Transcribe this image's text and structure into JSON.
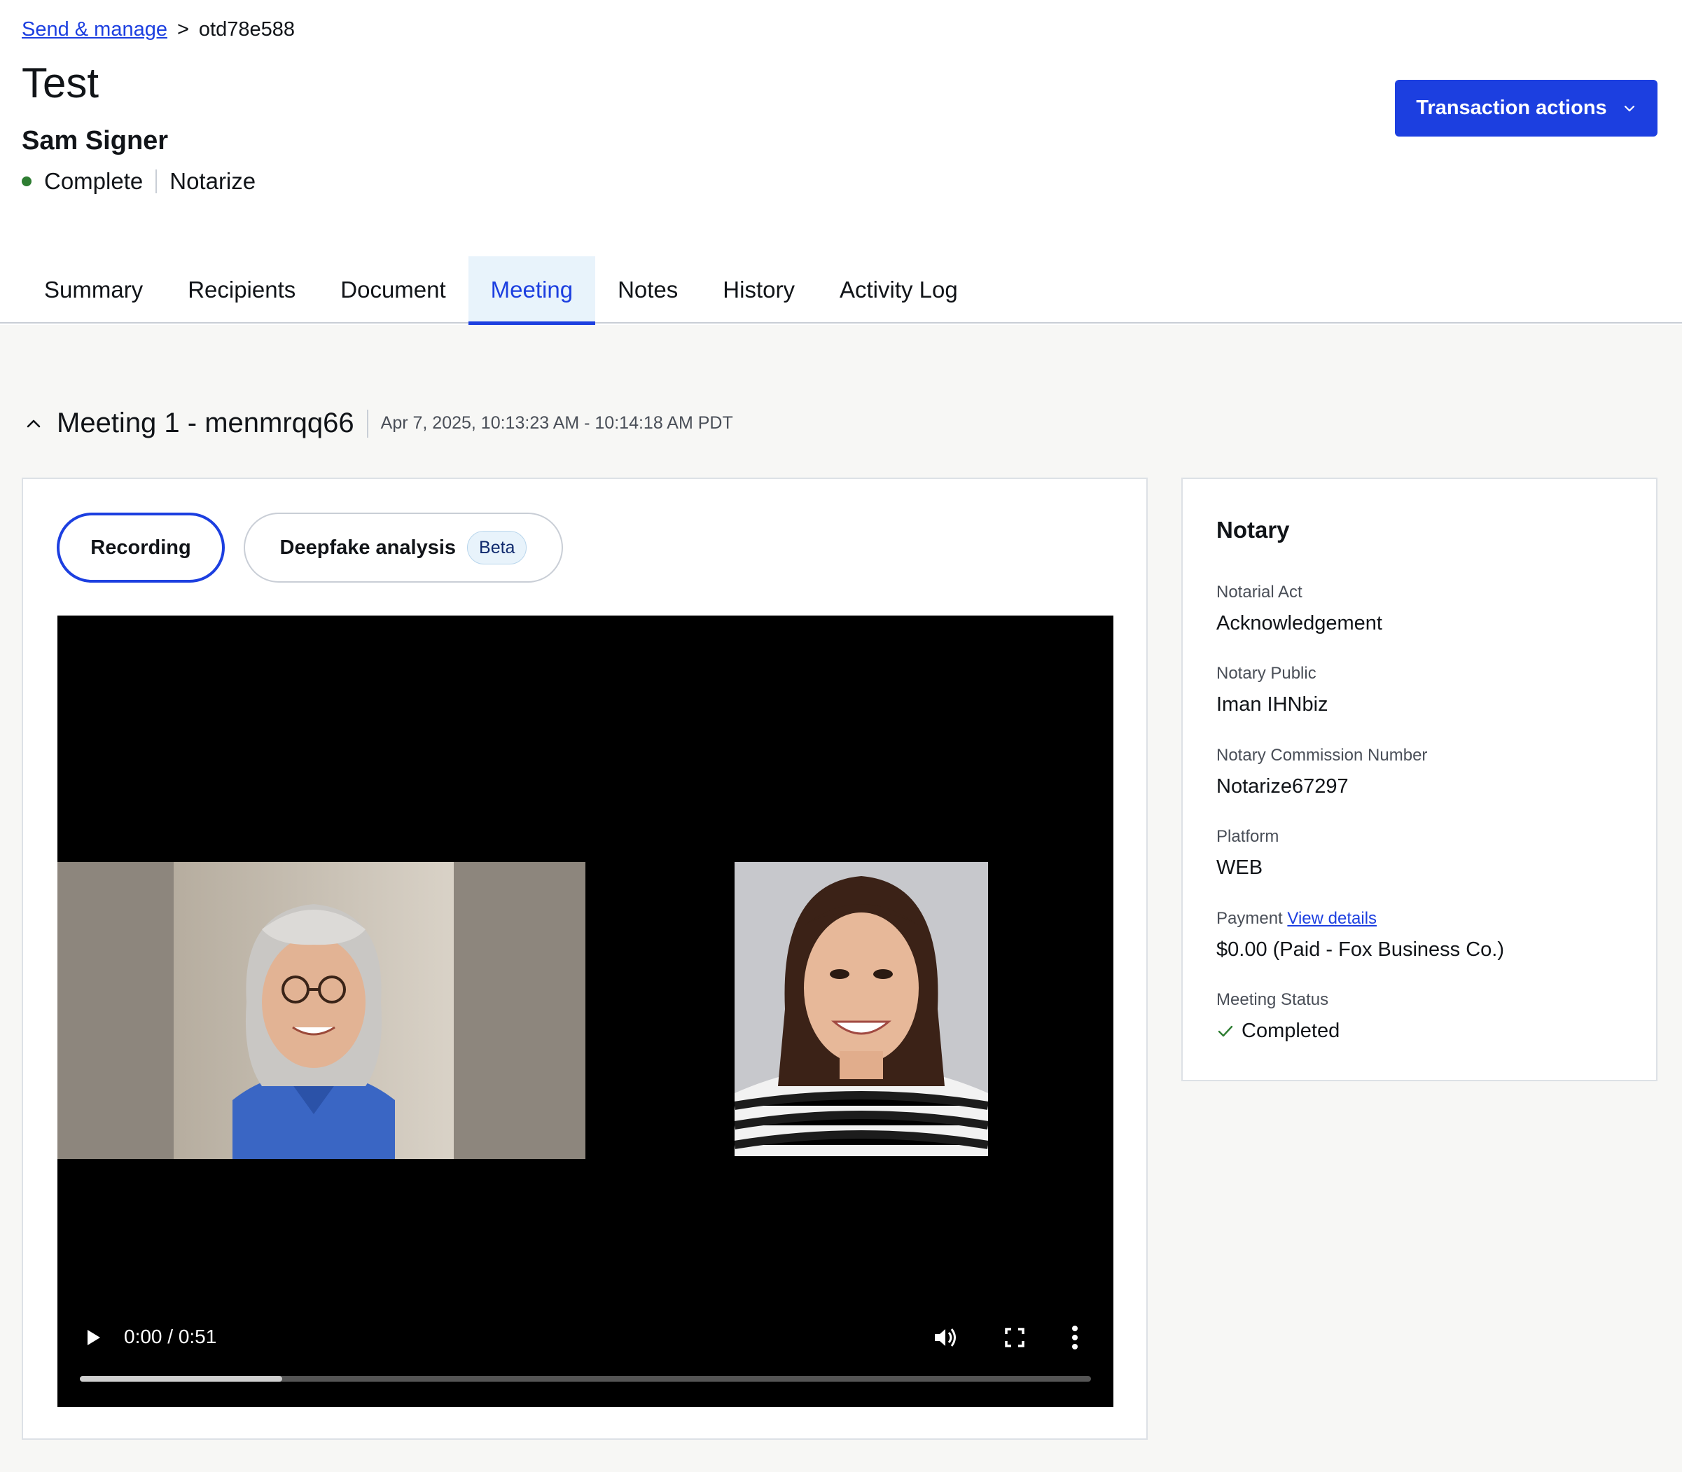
{
  "breadcrumb": {
    "parent_label": "Send & manage",
    "separator": ">",
    "current": "otd78e588"
  },
  "page": {
    "title": "Test",
    "signer_name": "Sam Signer",
    "status": "Complete",
    "transaction_type": "Notarize"
  },
  "actions": {
    "transaction_actions_label": "Transaction actions"
  },
  "tabs": [
    {
      "label": "Summary"
    },
    {
      "label": "Recipients"
    },
    {
      "label": "Document"
    },
    {
      "label": "Meeting"
    },
    {
      "label": "Notes"
    },
    {
      "label": "History"
    },
    {
      "label": "Activity Log"
    }
  ],
  "active_tab": "Meeting",
  "meeting": {
    "title": "Meeting 1 - menmrqq66",
    "time_range": "Apr 7, 2025, 10:13:23 AM - 10:14:18 AM PDT",
    "view_toggle": {
      "recording_label": "Recording",
      "deepfake_label": "Deepfake analysis",
      "beta_label": "Beta"
    },
    "video": {
      "current_time": "0:00",
      "duration": "0:51",
      "time_display": "0:00 / 0:51",
      "buffered_fraction": 0.2
    }
  },
  "notary": {
    "title": "Notary",
    "fields": [
      {
        "label": "Notarial Act",
        "value": "Acknowledgement"
      },
      {
        "label": "Notary Public",
        "value": "Iman IHNbiz"
      },
      {
        "label": "Notary Commission Number",
        "value": "Notarize67297"
      },
      {
        "label": "Platform",
        "value": "WEB"
      },
      {
        "label": "Payment",
        "link": "View details",
        "value": "$0.00 (Paid - Fox Business Co.)"
      },
      {
        "label": "Meeting Status",
        "value": "Completed"
      }
    ]
  },
  "colors": {
    "accent": "#1c3fe0",
    "status_complete": "#2e7d32",
    "tab_active_bg": "#e8f3fb",
    "page_bg": "#f7f7f5"
  }
}
